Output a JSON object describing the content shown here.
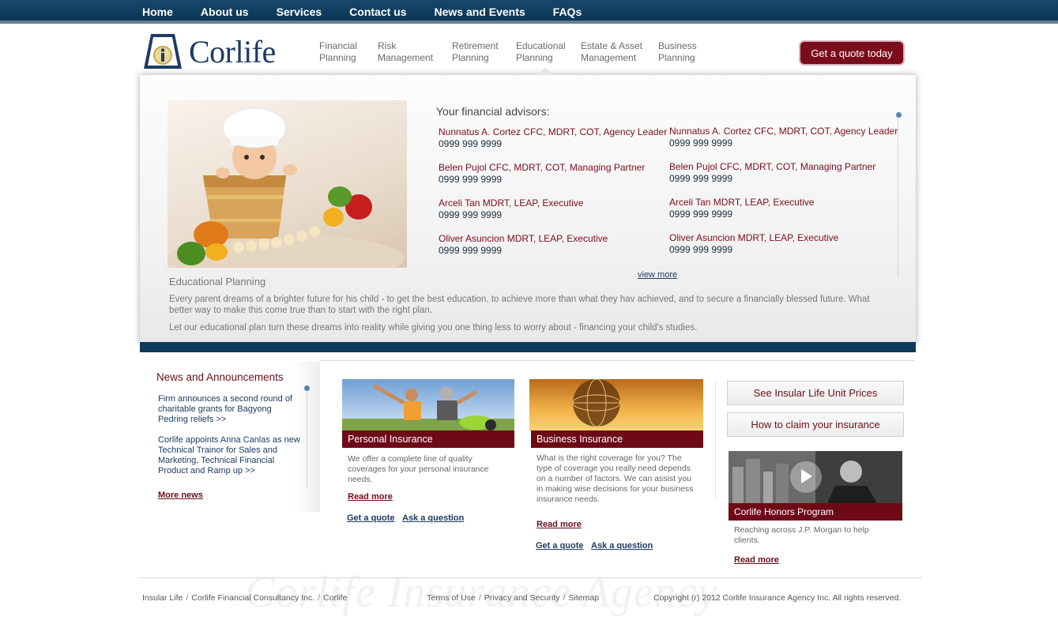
{
  "topnav": [
    "Home",
    "About us",
    "Services",
    "Contact us",
    "News and Events",
    "FAQs"
  ],
  "brand": {
    "name": "Corlife",
    "logo_letter": "i"
  },
  "mainnav": [
    "Financial\nPlanning",
    "Risk\nManagement",
    "Retirement\nPlanning",
    "Educational\nPlanning",
    "Estate & Asset\nManagement",
    "Business\nPlanning"
  ],
  "quote_button": "Get a quote today",
  "advisors": {
    "title": "Your financial advisors:",
    "left": [
      {
        "name": "Nunnatus A. Cortez CFC, MDRT, COT, Agency Leader",
        "phone": "0999 999 9999"
      },
      {
        "name": "Belen Pujol CFC, MDRT, COT, Managing Partner",
        "phone": "0999 999 9999"
      },
      {
        "name": "Arceli Tan MDRT, LEAP, Executive",
        "phone": "0999 999 9999"
      },
      {
        "name": "Oliver Asuncion MDRT, LEAP, Executive",
        "phone": "0999 999 9999"
      }
    ],
    "right": [
      {
        "name": "Nunnatus A. Cortez CFC, MDRT, COT, Agency Leader",
        "phone": "0999 999 9999"
      },
      {
        "name": "Belen Pujol CFC, MDRT, COT, Managing Partner",
        "phone": "0999 999 9999"
      },
      {
        "name": "Arceli Tan MDRT, LEAP, Executive",
        "phone": "0999 999 9999"
      },
      {
        "name": "Oliver Asuncion MDRT, LEAP, Executive",
        "phone": "0999 999 9999"
      }
    ],
    "view_more": "view more"
  },
  "hero": {
    "heading": "Educational Planning",
    "paragraph1": "Every parent dreams of a brighter future for his child - to get the best education, to achieve more than what they hav achieved, and to secure a financially blessed future. What better way to make this come true than to start with the right plan.",
    "paragraph2": "Let our educational plan turn these dreams into reality while giving you one thing less to worry about - financing your child's studies."
  },
  "news": {
    "title": "News and Announcements",
    "items": [
      "Firm announces a second round of charitable grants for Bagyong Pedring reliefs >>",
      "Corlife appoints Anna Canlas as new Technical Trainor for Sales and Marketing, Technical Financial Product and Ramp up >>"
    ],
    "more": "More news"
  },
  "products": [
    {
      "label": "Personal Insurance",
      "text": "We offer a complete line of quality coverages for your personal insurance needs.",
      "read_more": "Read more",
      "get_quote": "Get a quote",
      "ask": "Ask a question"
    },
    {
      "label": "Business Insurance",
      "text": "What is the right coverage for you? The type of coverage you really need depends on a number of factors. We can assist you in making wise decisions for your business insurance needs.",
      "read_more": "Read more",
      "get_quote": "Get a quote",
      "ask": "Ask a question"
    }
  ],
  "side": {
    "btn1": "See Insular Life Unit Prices",
    "btn2": "How to claim your insurance",
    "video_label": "Corlife Honors Program",
    "video_text": "Reaching across J.P. Morgan to help clients.",
    "read_more": "Read more"
  },
  "footer": {
    "left": [
      "Insular Life",
      "Corlife Financial Consultancy Inc.",
      "Corlife"
    ],
    "mid": [
      "Terms of Use",
      "Privacy and Security",
      "Sitemap"
    ],
    "copyright": "Copyright (r) 2012 Corlife Insurance Agency Inc. All rights reserved.",
    "watermark": "Corlife Insurance Agency"
  },
  "colors": {
    "navy": "#0c3656",
    "maroon": "#6e0a17",
    "link": "#1d3b63"
  }
}
